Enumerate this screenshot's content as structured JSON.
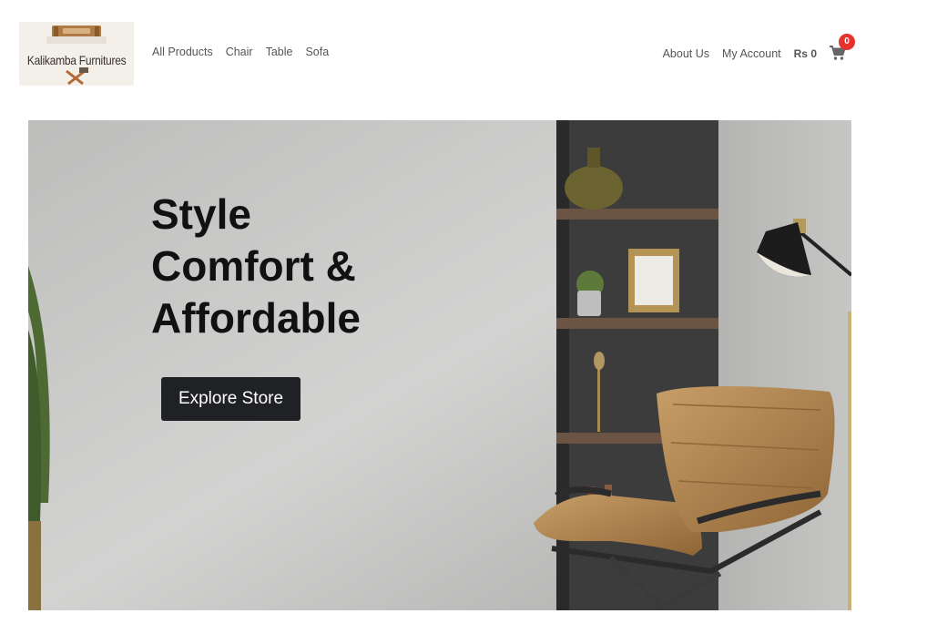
{
  "brand": {
    "name": "Kalikamba Furnitures"
  },
  "nav": {
    "left": [
      "All Products",
      "Chair",
      "Table",
      "Sofa"
    ],
    "about": "About Us",
    "account": "My Account",
    "price": "Rs 0",
    "cart_count": "0"
  },
  "hero": {
    "lines": [
      "Style",
      "Comfort &",
      "Affordable"
    ],
    "button": "Explore Store"
  },
  "icons": {
    "cart": "cart-icon",
    "logo": "bed-logo-icon"
  },
  "colors": {
    "button_bg": "#1f2125",
    "badge": "#e5322d",
    "wall": "#c9c9c8",
    "chair": "#b88d55"
  }
}
